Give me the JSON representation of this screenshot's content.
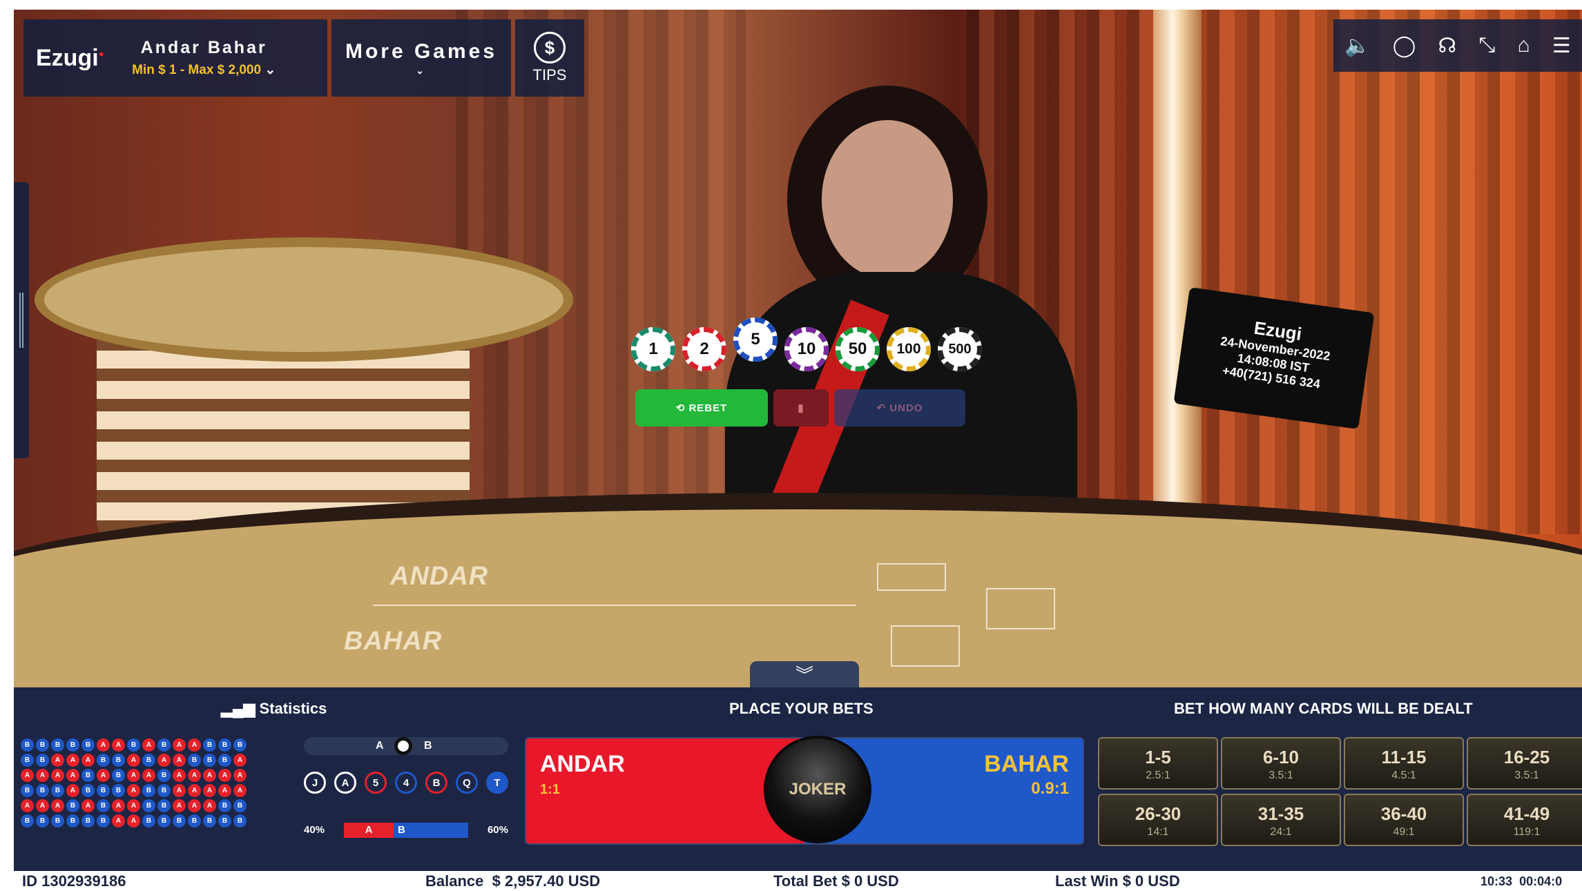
{
  "header": {
    "brand": "Ezugi",
    "game_name": "Andar Bahar",
    "limits": "Min $ 1 - Max $ 2,000",
    "more_games": "More Games",
    "tips_label": "TIPS",
    "tips_symbol": "$"
  },
  "toolbar_icons": [
    "sound-icon",
    "chat-icon",
    "support-icon",
    "fullscreen-icon",
    "home-icon",
    "menu-icon"
  ],
  "scene": {
    "table_left": "ANDAR",
    "table_right": "BAHAR",
    "monitor_brand": "Ezugi",
    "monitor_date": "24-November-2022",
    "monitor_time": "14:08:08 IST",
    "monitor_phone": "+40(721) 516 324"
  },
  "chips": [
    {
      "value": "1",
      "color": "#1a8a6a"
    },
    {
      "value": "2",
      "color": "#d6202a"
    },
    {
      "value": "5",
      "color": "#1f4fc0",
      "selected": true
    },
    {
      "value": "10",
      "color": "#7a2aa0"
    },
    {
      "value": "50",
      "color": "#1a9a3a"
    },
    {
      "value": "100",
      "color": "#e0b020"
    },
    {
      "value": "500",
      "color": "#222222"
    }
  ],
  "actions": {
    "rebet": "REBET",
    "undo": "UNDO"
  },
  "panel": {
    "statistics": "Statistics",
    "place_bets": "PLACE YOUR BETS",
    "cards_title": "BET HOW MANY CARDS WILL BE DEALT",
    "ab_a": "A",
    "ab_b": "B",
    "circles": [
      {
        "label": "J",
        "style": "white"
      },
      {
        "label": "A",
        "style": "white"
      },
      {
        "label": "5",
        "style": "red"
      },
      {
        "label": "4",
        "style": "blue"
      },
      {
        "label": "B",
        "style": "red"
      },
      {
        "label": "Q",
        "style": "blue"
      },
      {
        "label": "T",
        "style": "fill"
      }
    ],
    "pct_left": "40%",
    "pct_right": "60%",
    "pct_a": "A",
    "pct_b": "B"
  },
  "bead_road": [
    "BBBBBAABABAABBB",
    "BBAAABBABAABBBA",
    "AAAABABAABAAAAA",
    "BBBABBBABBAAAAA",
    "AAABABAABBAAABB",
    "BBBBBBAABBBBBBB"
  ],
  "bets": {
    "andar": {
      "name": "ANDAR",
      "odds": "1:1"
    },
    "bahar": {
      "name": "BAHAR",
      "odds": "0.9:1"
    },
    "joker": "JOKER"
  },
  "card_bets": [
    {
      "range": "1-5",
      "odds": "2.5:1"
    },
    {
      "range": "6-10",
      "odds": "3.5:1"
    },
    {
      "range": "11-15",
      "odds": "4.5:1"
    },
    {
      "range": "16-25",
      "odds": "3.5:1"
    },
    {
      "range": "26-30",
      "odds": "14:1"
    },
    {
      "range": "31-35",
      "odds": "24:1"
    },
    {
      "range": "36-40",
      "odds": "49:1"
    },
    {
      "range": "41-49",
      "odds": "119:1"
    }
  ],
  "footer": {
    "id": "ID 1302939186",
    "balance_label": "Balance",
    "balance": "$ 2,957.40 USD",
    "total_bet": "Total Bet $ 0 USD",
    "last_win": "Last Win $ 0 USD",
    "clock": "10:33",
    "timer": "00:04:0"
  }
}
